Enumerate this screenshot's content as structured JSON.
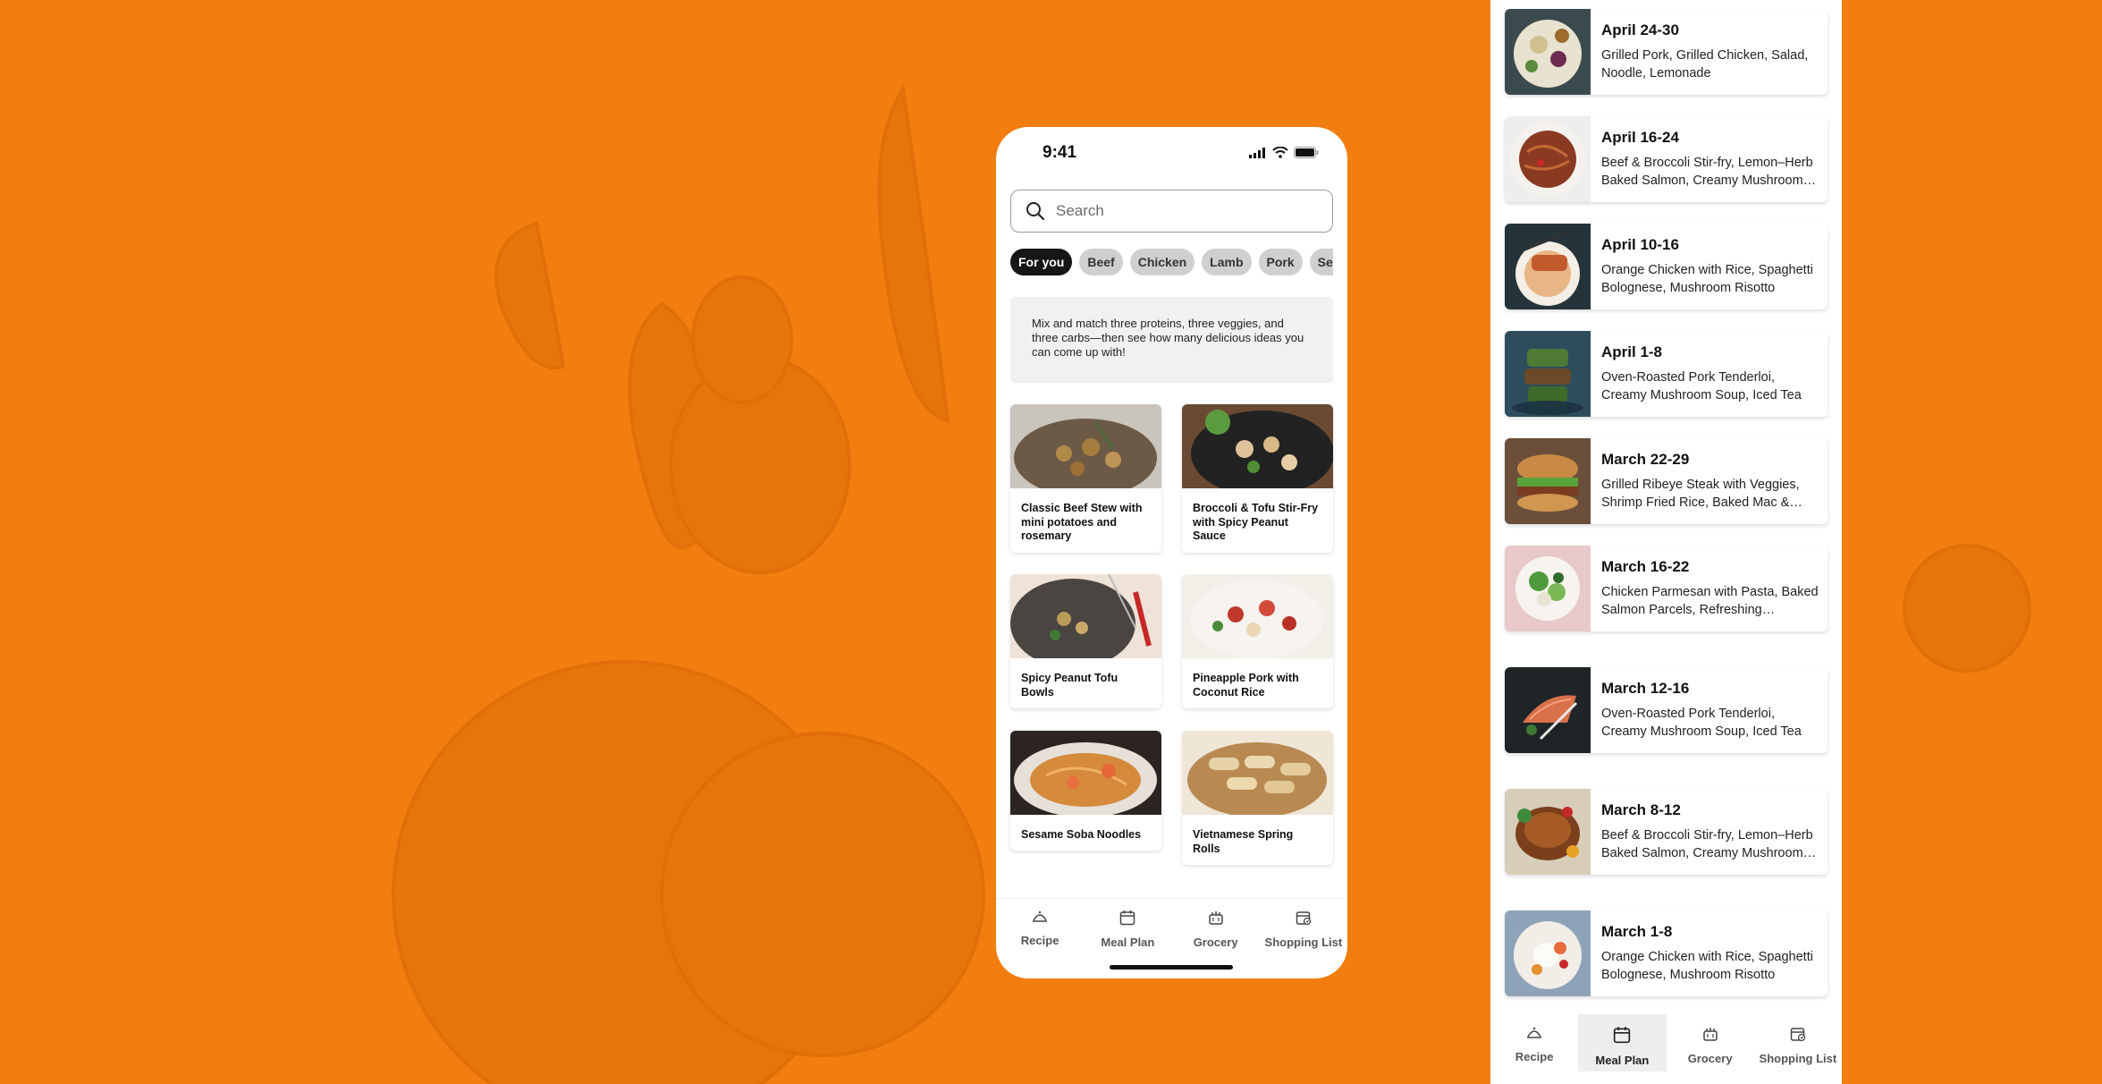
{
  "colors": {
    "background": "#F27E10",
    "chip_active": "#161616",
    "chip": "#cfcfcf"
  },
  "phone": {
    "status": {
      "time": "9:41"
    },
    "search": {
      "placeholder": "Search"
    },
    "chips": [
      {
        "label": "For you",
        "active": true
      },
      {
        "label": "Beef"
      },
      {
        "label": "Chicken"
      },
      {
        "label": "Lamb"
      },
      {
        "label": "Pork"
      },
      {
        "label": "Seafood"
      }
    ],
    "info": "Mix and match three proteins, three veggies, and three carbs—then see how many delicious ideas you can come up with!",
    "recipes": [
      {
        "title": "Classic Beef Stew with mini potatoes and rosemary"
      },
      {
        "title": "Broccoli & Tofu Stir-Fry with Spicy Peanut Sauce"
      },
      {
        "title": "Spicy Peanut Tofu Bowls"
      },
      {
        "title": "Pineapple Pork with Coconut Rice"
      },
      {
        "title": "Sesame Soba Noodles"
      },
      {
        "title": "Vietnamese Spring Rolls"
      }
    ],
    "tabs": [
      {
        "label": "Recipe",
        "icon": "cloche-icon"
      },
      {
        "label": "Meal Plan",
        "icon": "calendar-icon"
      },
      {
        "label": "Grocery",
        "icon": "basket-icon"
      },
      {
        "label": "Shopping List",
        "icon": "list-calendar-icon"
      }
    ]
  },
  "meal_plan": {
    "items": [
      {
        "date": "April 24-30",
        "desc": "Grilled Pork, Grilled Chicken, Salad, Noodle, Lemonade"
      },
      {
        "date": "April 16-24",
        "desc": "Beef & Broccoli Stir-fry, Lemon–Herb Baked Salmon, Creamy Mushroom Soup"
      },
      {
        "date": "April 10-16",
        "desc": "Orange Chicken with Rice, Spaghetti Bolognese, Mushroom Risotto"
      },
      {
        "date": "April 1-8",
        "desc": "Oven-Roasted Pork Tenderloi, Creamy Mushroom Soup, Iced Tea"
      },
      {
        "date": "March 22-29",
        "desc": "Grilled Ribeye Steak with Veggies, Shrimp Fried Rice, Baked Mac & Cheese"
      },
      {
        "date": "March 16-22",
        "desc": "Chicken Parmesan with Pasta, Baked Salmon Parcels, Refreshing Lemonade"
      },
      {
        "date": "March 12-16",
        "desc": "Oven-Roasted Pork Tenderloi, Creamy Mushroom Soup, Iced Tea"
      },
      {
        "date": "March 8-12",
        "desc": "Beef & Broccoli Stir-fry, Lemon–Herb Baked Salmon, Creamy Mushroom Soup"
      },
      {
        "date": "March 1-8",
        "desc": "Orange Chicken with Rice, Spaghetti Bolognese, Mushroom Risotto"
      }
    ],
    "tabs": [
      {
        "label": "Recipe",
        "icon": "cloche-icon"
      },
      {
        "label": "Meal Plan",
        "icon": "calendar-icon",
        "active": true
      },
      {
        "label": "Grocery",
        "icon": "basket-icon"
      },
      {
        "label": "Shopping List",
        "icon": "list-calendar-icon"
      }
    ]
  }
}
